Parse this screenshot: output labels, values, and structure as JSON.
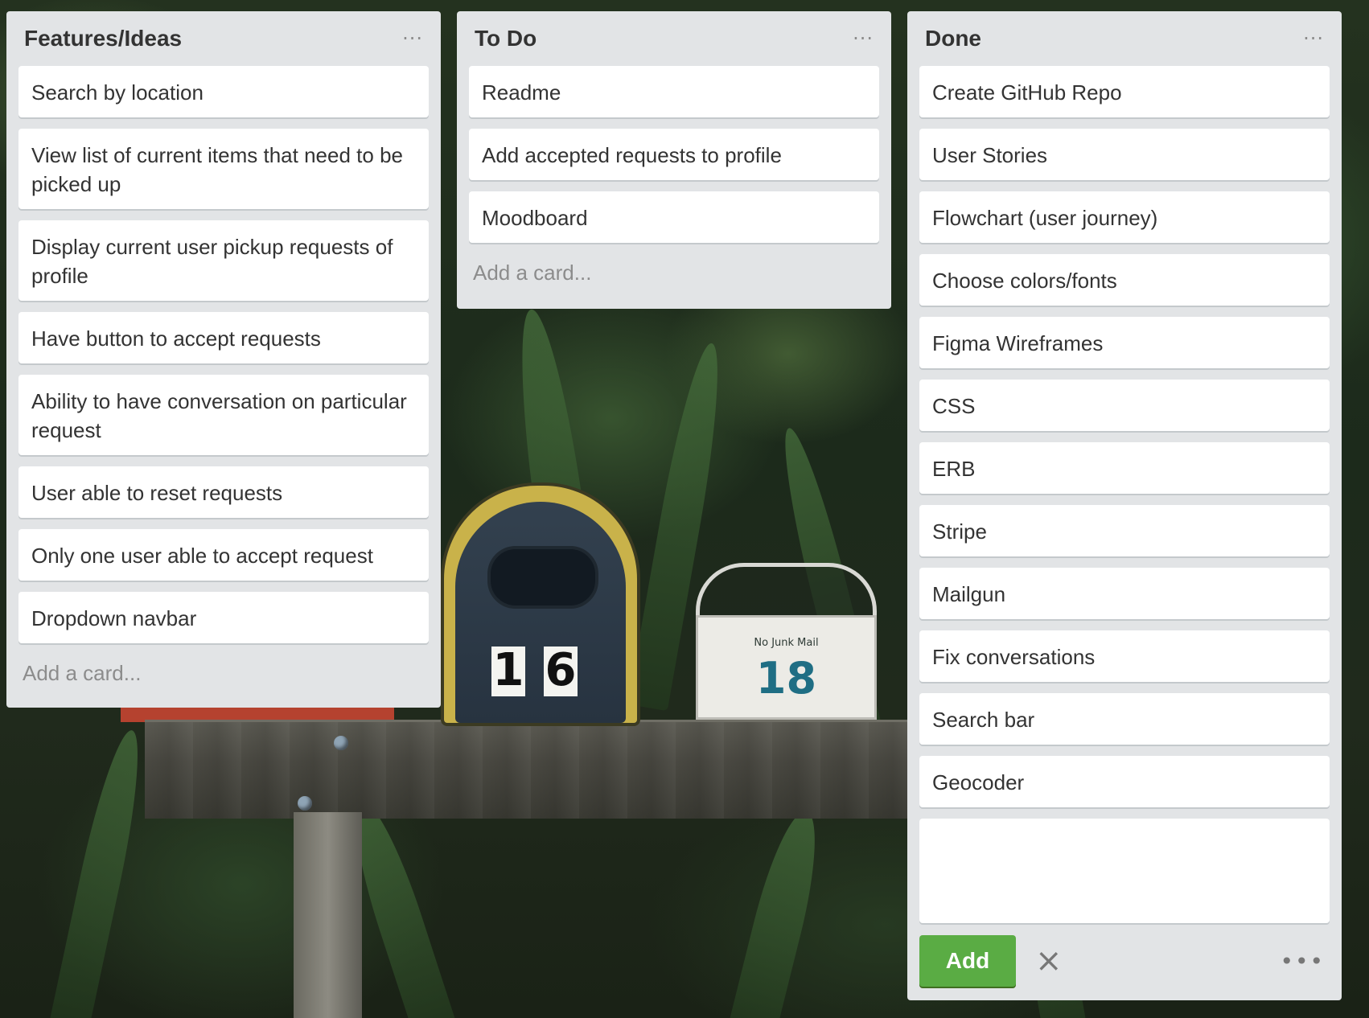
{
  "lists": [
    {
      "title": "Features/Ideas",
      "menu": "···",
      "cards": [
        "Search by location",
        "View list of current items that need to be picked up",
        "Display current user pickup requests of profile",
        "Have button to accept requests",
        "Ability to have conversation on particular request",
        "User able to reset requests",
        "Only one user able to accept request",
        "Dropdown navbar"
      ],
      "add_card": "Add a card..."
    },
    {
      "title": "To Do",
      "menu": "···",
      "cards": [
        "Readme",
        "Add accepted requests to profile",
        "Moodboard"
      ],
      "add_card": "Add a card..."
    },
    {
      "title": "Done",
      "menu": "···",
      "cards": [
        "Create GitHub Repo",
        "User Stories",
        "Flowchart (user journey)",
        "Choose colors/fonts",
        "Figma Wireframes",
        "CSS",
        "ERB",
        "Stripe",
        "Mailgun",
        "Fix conversations",
        "Search bar",
        "Geocoder"
      ],
      "composer": {
        "value": "",
        "add_label": "Add",
        "close_icon": "×",
        "menu": "•••"
      }
    }
  ],
  "background": {
    "mailbox_left_digits": [
      "1",
      "6"
    ],
    "mailbox_right_label": "No Junk Mail",
    "mailbox_right_number": "18"
  },
  "colors": {
    "list_bg": "#e2e4e6",
    "card_bg": "#ffffff",
    "add_button": "#5aac44"
  }
}
